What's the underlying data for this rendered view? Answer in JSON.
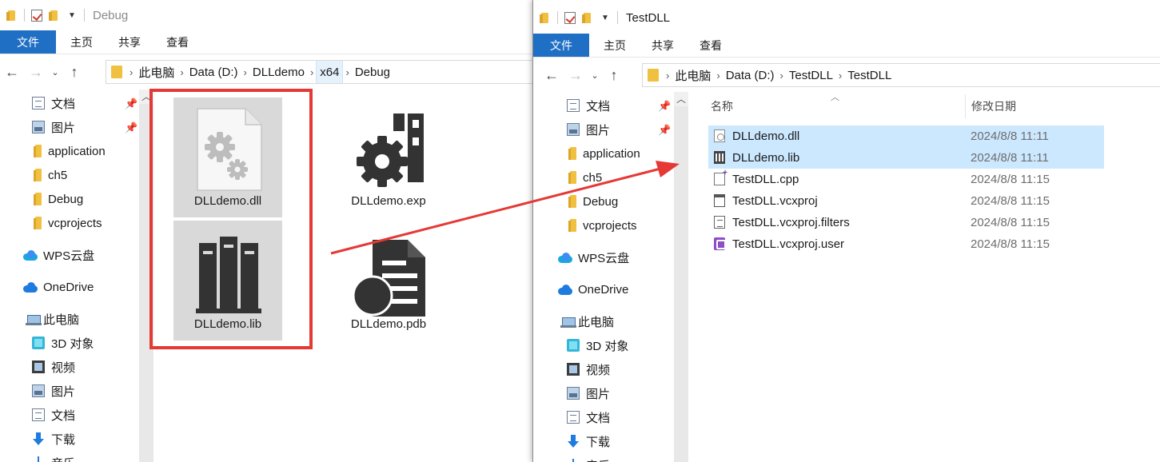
{
  "left_window": {
    "title": "Debug",
    "ribbon": {
      "file": "文件",
      "home": "主页",
      "share": "共享",
      "view": "查看"
    },
    "breadcrumb": [
      "此电脑",
      "Data (D:)",
      "DLLdemo",
      "x64",
      "Debug"
    ],
    "nav": [
      "文档",
      "图片",
      "application",
      "ch5",
      "Debug",
      "vcprojects",
      "WPS云盘",
      "OneDrive",
      "此电脑",
      "3D 对象",
      "视频",
      "图片",
      "文档",
      "下载",
      "音乐"
    ],
    "files": [
      {
        "name": "DLLdemo.dll",
        "icon": "gear-file-icon",
        "selected": true
      },
      {
        "name": "DLLdemo.exp",
        "icon": "exp-file-icon",
        "selected": false
      },
      {
        "name": "DLLdemo.lib",
        "icon": "library-file-icon",
        "selected": true
      },
      {
        "name": "DLLdemo.pdb",
        "icon": "pdb-file-icon",
        "selected": false
      }
    ]
  },
  "right_window": {
    "title": "TestDLL",
    "ribbon": {
      "file": "文件",
      "home": "主页",
      "share": "共享",
      "view": "查看"
    },
    "breadcrumb": [
      "此电脑",
      "Data (D:)",
      "TestDLL",
      "TestDLL"
    ],
    "nav": [
      "文档",
      "图片",
      "application",
      "ch5",
      "Debug",
      "vcprojects",
      "WPS云盘",
      "OneDrive",
      "此电脑",
      "3D 对象",
      "视频",
      "图片",
      "文档",
      "下载",
      "音乐"
    ],
    "columns": {
      "name": "名称",
      "modified": "修改日期"
    },
    "files": [
      {
        "name": "DLLdemo.dll",
        "date": "2024/8/8 11:11",
        "icon": "dll-icon",
        "selected": true
      },
      {
        "name": "DLLdemo.lib",
        "date": "2024/8/8 11:11",
        "icon": "lib-icon",
        "selected": true
      },
      {
        "name": "TestDLL.cpp",
        "date": "2024/8/8 11:15",
        "icon": "cpp-icon",
        "selected": false
      },
      {
        "name": "TestDLL.vcxproj",
        "date": "2024/8/8 11:15",
        "icon": "vcxproj-icon",
        "selected": false
      },
      {
        "name": "TestDLL.vcxproj.filters",
        "date": "2024/8/8 11:15",
        "icon": "filters-icon",
        "selected": false
      },
      {
        "name": "TestDLL.vcxproj.user",
        "date": "2024/8/8 11:15",
        "icon": "user-icon",
        "selected": false
      }
    ]
  },
  "colors": {
    "accent": "#1f6fc5",
    "selection": "#cce8ff",
    "annotation": "#e53935"
  }
}
